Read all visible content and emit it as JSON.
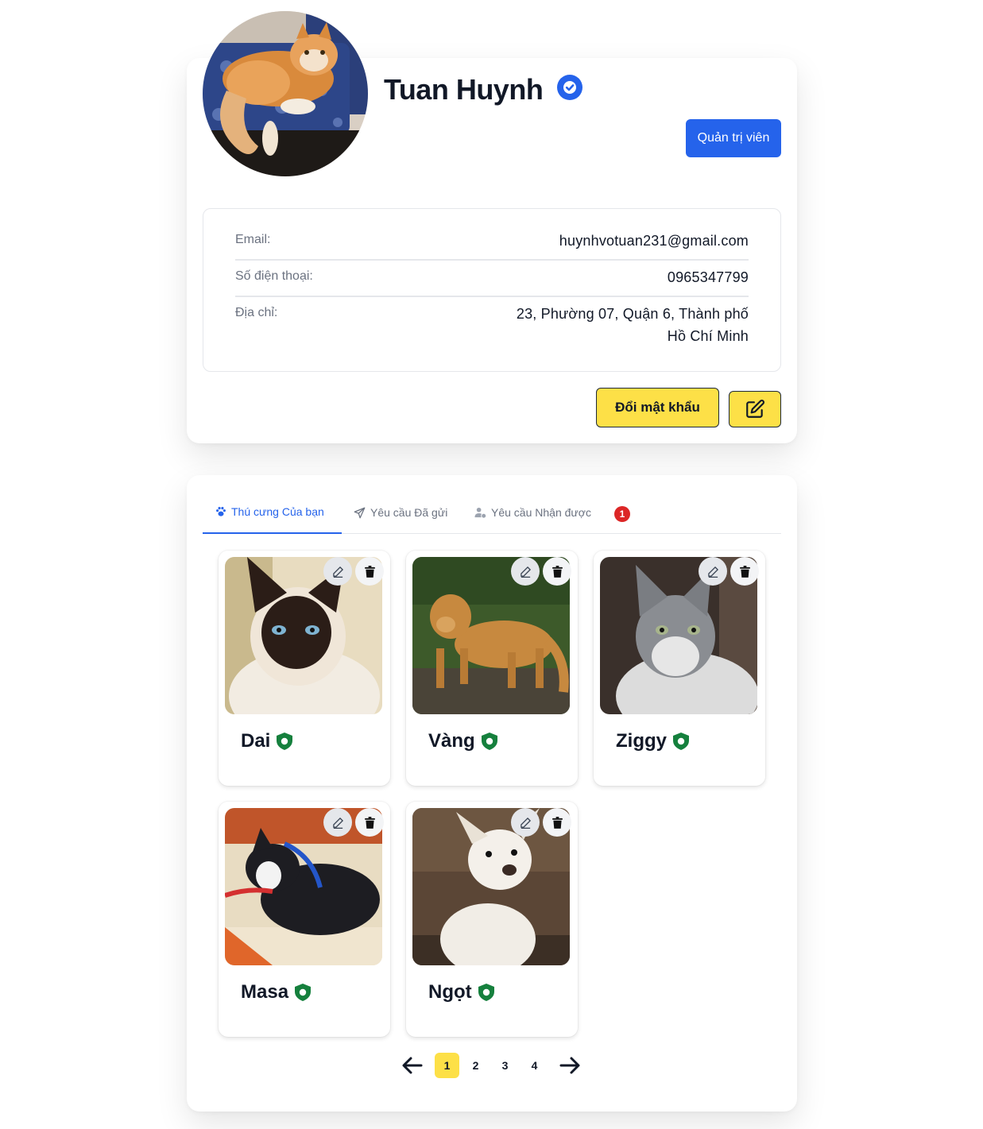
{
  "profile": {
    "name": "Tuan Huynh",
    "role_button": "Quản trị viên",
    "fields": [
      {
        "label": "Email:",
        "value": "huynhvotuan231@gmail.com"
      },
      {
        "label": "Số điện thoại:",
        "value": "0965347799"
      },
      {
        "label": "Địa chỉ:",
        "value": "23, Phường 07, Quận 6, Thành phố Hồ Chí Minh"
      }
    ],
    "change_password_label": "Đổi mật khẩu",
    "icons": {
      "verified": "verified-check-icon",
      "edit": "edit-square-icon"
    },
    "colors": {
      "primary": "#2563eb",
      "accent": "#fde047",
      "badge": "#dc2626",
      "verified_pet": "#15803d"
    }
  },
  "tabs": [
    {
      "label": "Thú cưng Của bạn",
      "icon": "paw-icon",
      "active": true
    },
    {
      "label": "Yêu cầu Đã gửi",
      "icon": "send-icon",
      "active": false
    },
    {
      "label": "Yêu cầu Nhận được",
      "icon": "user-clock-icon",
      "active": false,
      "badge": "1"
    }
  ],
  "pets": [
    {
      "name": "Dai",
      "photo": "siamese-cat-photo"
    },
    {
      "name": "Vàng",
      "photo": "golden-retriever-photo"
    },
    {
      "name": "Ziggy",
      "photo": "gray-white-cat-photo"
    },
    {
      "name": "Masa",
      "photo": "boston-terrier-photo"
    },
    {
      "name": "Ngọt",
      "photo": "white-chihuahua-photo"
    }
  ],
  "pagination": {
    "pages": [
      "1",
      "2",
      "3",
      "4"
    ],
    "current": "1"
  }
}
